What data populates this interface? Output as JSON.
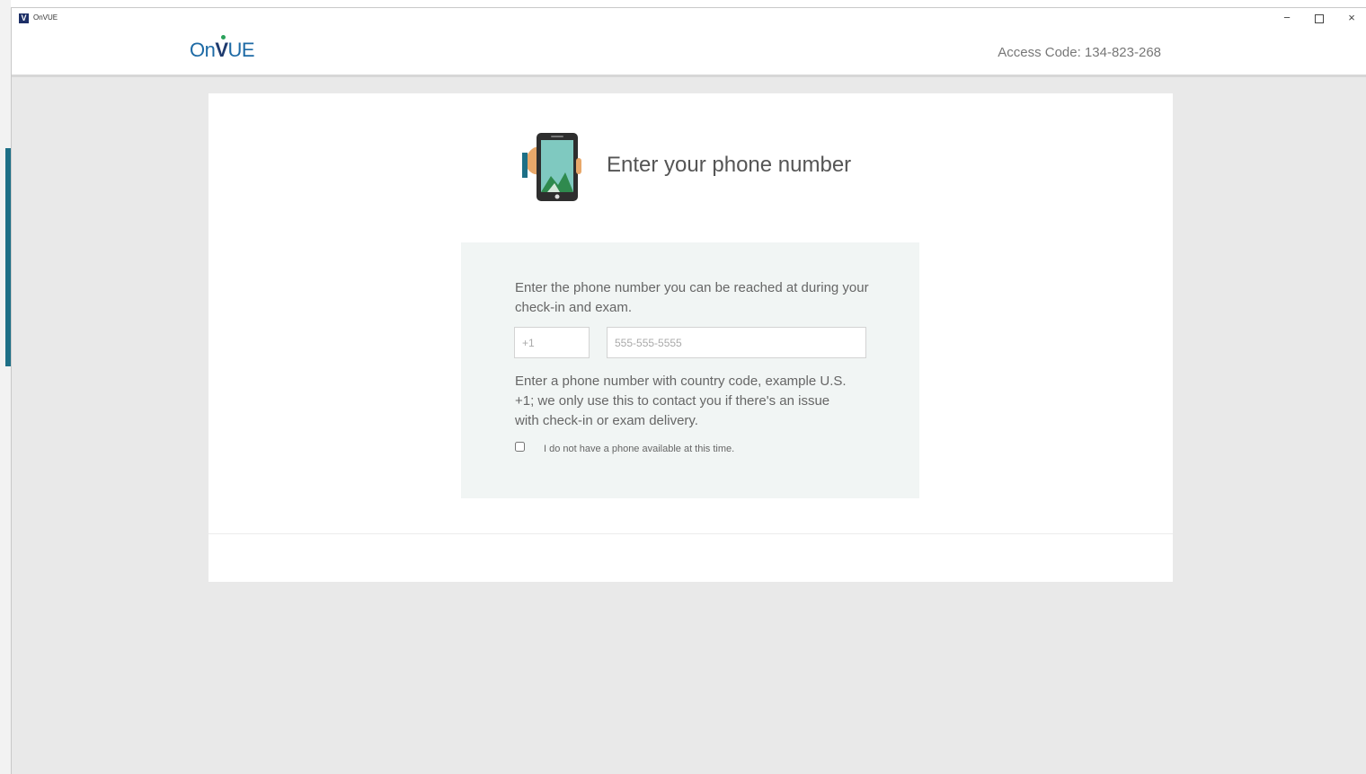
{
  "window": {
    "title": "OnVUE",
    "app_icon_letter": "V",
    "minimize_symbol": "−",
    "close_symbol": "×"
  },
  "header": {
    "logo_text": "On",
    "logo_v": "V",
    "logo_suffix": "UE",
    "access_code": "Access Code: 134-823-268"
  },
  "main": {
    "icon": "phone-icon",
    "heading": "Enter your phone number",
    "instruction": "Enter the phone number you can be reached at during your check-in and exam.",
    "country_code": {
      "value": "",
      "placeholder": "+1"
    },
    "phone_number": {
      "value": "",
      "placeholder": "555-555-5555"
    },
    "help_text": "Enter a phone number with country code, example U.S. +1; we only use this to contact you if there's an issue with check-in or exam delivery.",
    "no_phone_label": "I do not have a phone available at this time.",
    "no_phone_checked": false
  },
  "colors": {
    "brand_blue": "#1d6aa5",
    "brand_navy": "#1d3a6e",
    "panel_bg": "#f1f5f4",
    "phone_screen": "#7fc9c0"
  }
}
